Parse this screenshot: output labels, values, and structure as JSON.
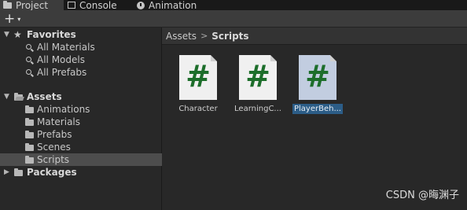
{
  "tabs": [
    {
      "label": "Project",
      "icon": "folder-icon",
      "active": true
    },
    {
      "label": "Console",
      "icon": "console-icon",
      "active": false
    },
    {
      "label": "Animation",
      "icon": "animation-icon",
      "active": false
    }
  ],
  "toolbar": {
    "add_label": "+",
    "add_caret": "▾"
  },
  "sidebar": {
    "favorites": {
      "label": "Favorites",
      "items": [
        "All Materials",
        "All Models",
        "All Prefabs"
      ]
    },
    "assets": {
      "label": "Assets",
      "items": [
        "Animations",
        "Materials",
        "Prefabs",
        "Scenes",
        "Scripts"
      ],
      "selected": "Scripts"
    },
    "packages": {
      "label": "Packages"
    }
  },
  "breadcrumb": {
    "root": "Assets",
    "separator": ">",
    "current": "Scripts"
  },
  "assets": [
    {
      "name": "Character",
      "glyph": "#",
      "selected": false
    },
    {
      "name": "LearningC...",
      "glyph": "#",
      "selected": false
    },
    {
      "name": "PlayerBeh...",
      "glyph": "#",
      "selected": true
    }
  ],
  "watermark": "CSDN @晦渊子",
  "colors": {
    "script_glyph": "#1d6e2b",
    "selection": "#2c5d87",
    "background": "#282828"
  }
}
